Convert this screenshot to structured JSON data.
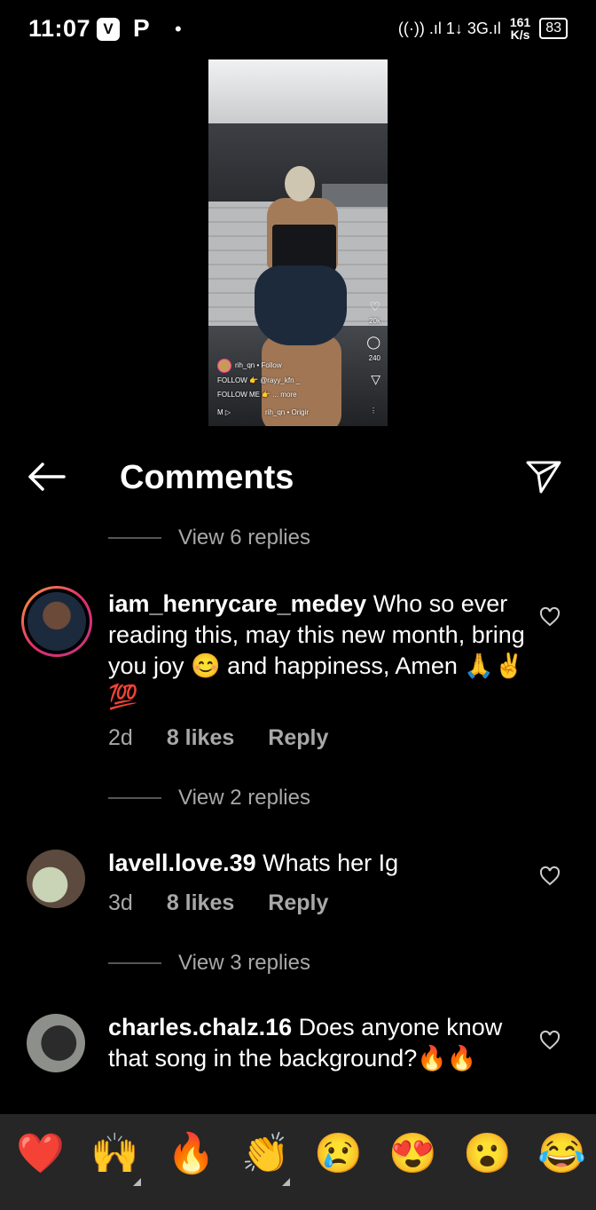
{
  "status_bar": {
    "time": "11:07",
    "app_icon_1": "V",
    "app_icon_2": "P",
    "dot": "•",
    "signal": "((·)) .ıl 1↓ 3G.ıl",
    "net_speed_value": "161",
    "net_speed_unit": "K/s",
    "battery": "83"
  },
  "video": {
    "likes": "20k",
    "comments_count": "240",
    "user_line": "rih_qn • Follow",
    "caption_line1": "FOLLOW 👉 @rayy_kfn _",
    "caption_line2": "FOLLOW ME 👉 ... more",
    "audio_line": "rih_qn • Origir",
    "meta_label": "M ▷"
  },
  "header": {
    "title": "Comments"
  },
  "threads": [
    {
      "view_replies": "View 6 replies"
    },
    {
      "view_replies": "View 2 replies"
    },
    {
      "view_replies": "View 3 replies"
    }
  ],
  "comments": [
    {
      "username": "iam_henrycare_medey",
      "text": " Who so ever reading this, may this new month,  bring you joy 😊 and happiness, Amen 🙏✌️💯",
      "age": "2d",
      "likes": "8 likes",
      "reply": "Reply"
    },
    {
      "username": "lavell.love.39",
      "text": " Whats her Ig",
      "age": "3d",
      "likes": "8 likes",
      "reply": "Reply"
    },
    {
      "username": "charles.chalz.16",
      "text": " Does anyone know that song in the background?🔥🔥"
    }
  ],
  "emoji_bar": [
    "❤️",
    "🙌",
    "🔥",
    "👏",
    "😢",
    "😍",
    "😮",
    "😂"
  ],
  "icons": {
    "back": "arrow-left-icon",
    "send": "paper-plane-icon",
    "like": "heart-outline-icon"
  }
}
